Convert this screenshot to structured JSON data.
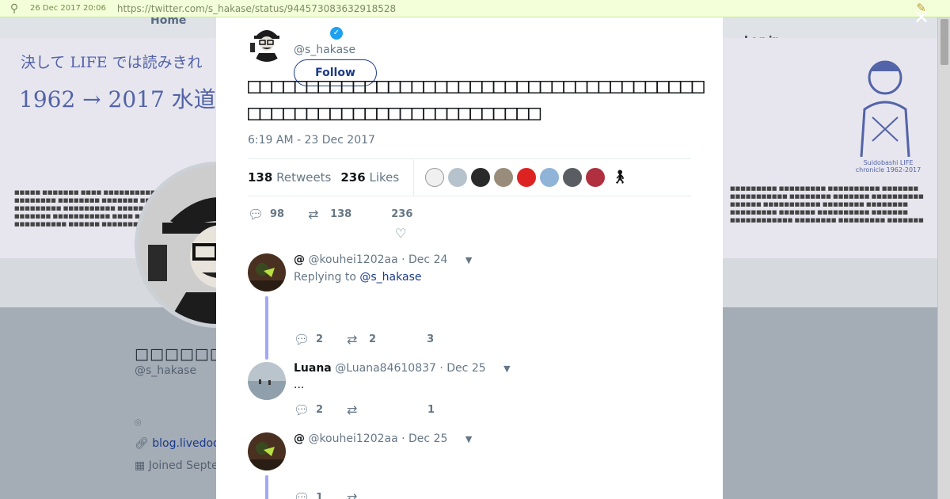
{
  "archive": {
    "date": "26 Dec 2017 20:06",
    "url": "https://twitter.com/s_hakase/status/944573083632918528"
  },
  "background": {
    "nav_home": "Home",
    "nav_login": "Log in ▾",
    "banner_line1": "決して LIFE では読みきれ",
    "banner_line2": "1962 → 2017 水道",
    "banner_caption": "Suidobashi LIFE chronicle 1962-2017",
    "profile_name": "□□□□□□□□□□□□",
    "profile_handle": "@s_hakase",
    "link": "blog.livedoo",
    "joined": "Joined Septe"
  },
  "tweet": {
    "handle": "@s_hakase",
    "follow_label": "Follow",
    "text": "□□□□□□□□□□□□□□□□□□□□□□□□□□□□□□□□□□□□□□□□□□□□□□□□□□□□□□□□□□□□□□□□",
    "time": "6:19 AM - 23 Dec 2017",
    "retweets_count": "138",
    "retweets_label": "Retweets",
    "likes_count": "236",
    "likes_label": "Likes",
    "reply_count": "98",
    "retweet_count": "138",
    "like_count": "236"
  },
  "replies": [
    {
      "name": "@",
      "handle": "@kouhei1202aa",
      "date": "· Dec 24",
      "replying_to_label": "Replying to",
      "replying_to": "@s_hakase",
      "text": "",
      "replies": "2",
      "retweets": "2",
      "likes": "3"
    },
    {
      "name": "Luana",
      "handle": "@Luana84610837",
      "date": "· Dec 25",
      "text": "...",
      "replies": "2",
      "retweets": "",
      "likes": "1"
    },
    {
      "name": "@",
      "handle": "@kouhei1202aa",
      "date": "· Dec 25",
      "text": "",
      "replies": "1",
      "retweets": "",
      "likes": ""
    }
  ],
  "icons": {
    "reply": "reply-icon",
    "retweet": "retweet-icon",
    "like": "heart-icon",
    "close": "close-icon",
    "verified": "verified-badge-icon"
  },
  "colors": {
    "link": "#1b3a8a",
    "thread_line": "#a4a7f7",
    "verified": "#1da1f2",
    "archive_bar": "#f2ffd8"
  }
}
